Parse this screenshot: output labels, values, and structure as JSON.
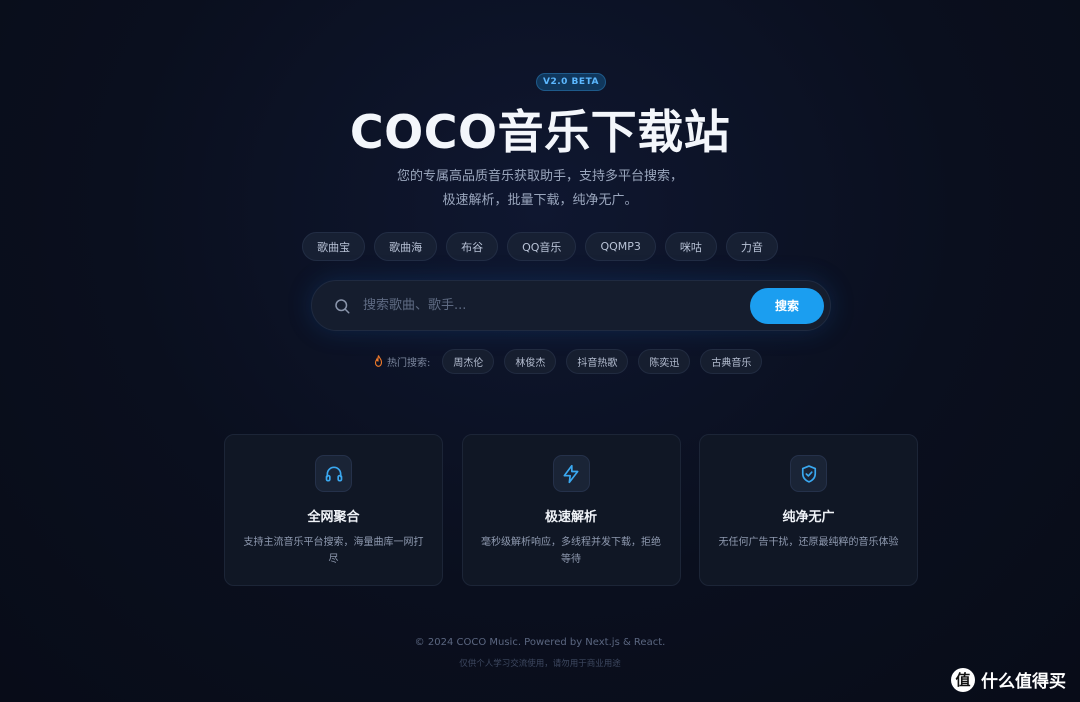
{
  "badge": "V2.0 BETA",
  "title": "COCO音乐下载站",
  "subtitle_line1": "您的专属高品质音乐获取助手，支持多平台搜索，",
  "subtitle_line2": "极速解析，批量下载，纯净无广。",
  "platforms": [
    "歌曲宝",
    "歌曲海",
    "布谷",
    "QQ音乐",
    "QQMP3",
    "咪咕",
    "力音"
  ],
  "search": {
    "placeholder": "搜索歌曲、歌手...",
    "value": "",
    "button_label": "搜索"
  },
  "hot_search": {
    "label": "热门搜索:",
    "items": [
      "周杰伦",
      "林俊杰",
      "抖音热歌",
      "陈奕迅",
      "古典音乐"
    ]
  },
  "features": [
    {
      "icon": "headphones-icon",
      "title": "全网聚合",
      "desc": "支持主流音乐平台搜索，海量曲库一网打尽"
    },
    {
      "icon": "lightning-icon",
      "title": "极速解析",
      "desc": "毫秒级解析响应，多线程并发下载，拒绝等待"
    },
    {
      "icon": "shield-check-icon",
      "title": "纯净无广",
      "desc": "无任何广告干扰，还原最纯粹的音乐体验"
    }
  ],
  "footer": {
    "line1": "© 2024 COCO Music. Powered by Next.js & React.",
    "line2": "仅供个人学习交流使用，请勿用于商业用途"
  },
  "watermark": {
    "logo": "值",
    "text": "什么值得买"
  },
  "colors": {
    "background": "#0b1020",
    "accent": "#1b9ef0",
    "badge_text": "#5cb8ff",
    "fire": "#f07a2a"
  }
}
